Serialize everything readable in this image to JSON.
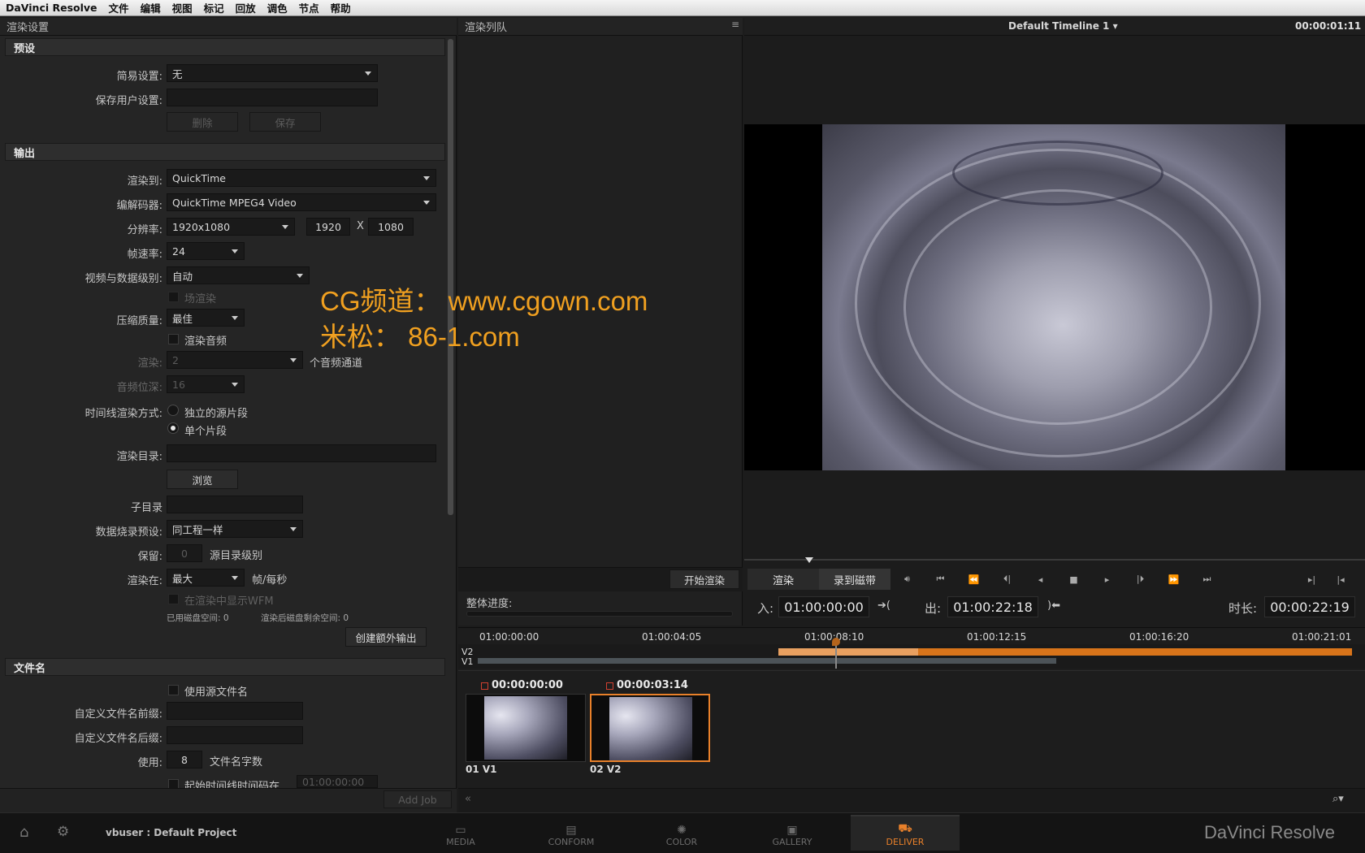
{
  "menu": [
    "DaVinci Resolve",
    "文件",
    "编辑",
    "视图",
    "标记",
    "回放",
    "调色",
    "节点",
    "帮助"
  ],
  "left_panel": {
    "title": "渲染设置",
    "preset_section": "预设",
    "easy_setup_label": "简易设置:",
    "easy_setup_value": "无",
    "save_user_label": "保存用户设置:",
    "delete_btn": "删除",
    "save_btn": "保存",
    "output_section": "输出",
    "render_to_label": "渲染到:",
    "render_to_value": "QuickTime",
    "codec_label": "编解码器:",
    "codec_value": "QuickTime MPEG4 Video",
    "resolution_label": "分辨率:",
    "resolution_value": "1920x1080",
    "width": "1920",
    "x_sep": "X",
    "height": "1080",
    "fps_label": "帧速率:",
    "fps_value": "24",
    "video_level_label": "视频与数据级别:",
    "video_level_value": "自动",
    "field_render": "场渲染",
    "quality_label": "压缩质量:",
    "quality_value": "最佳",
    "render_audio": "渲染音频",
    "render_label": "渲染:",
    "render_channels": "2",
    "channels_text": "个音频通道",
    "audio_bits_label": "音频位深:",
    "audio_bits_value": "16",
    "timeline_mode_label": "时间线渲染方式:",
    "mode_individual": "独立的源片段",
    "mode_single": "单个片段",
    "render_dir_label": "渲染目录:",
    "browse_btn": "浏览",
    "subdir_label": "子目录",
    "burn_label": "数据烧录预设:",
    "burn_value": "同工程一样",
    "keep_label": "保留:",
    "keep_value": "0",
    "keep_suffix": "源目录级别",
    "render_at_label": "渲染在:",
    "render_at_value": "最大",
    "render_at_suffix": "帧/每秒",
    "show_wfm": "在渲染中显示WFM",
    "disk_used": "已用磁盘空间: 0",
    "disk_left": "渲染后磁盘剩余空间: 0",
    "create_output_btn": "创建额外输出",
    "filename_section": "文件名",
    "use_source_name": "使用源文件名",
    "prefix_label": "自定义文件名前缀:",
    "suffix_label": "自定义文件名后缀:",
    "use_label": "使用:",
    "use_value": "8",
    "use_suffix": "文件名字数",
    "start_tc_label": "起始时间线时间码在",
    "start_tc_value": "01:00:00:00",
    "add_job_btn": "Add Job"
  },
  "queue": {
    "title": "渲染列队",
    "start_render_btn": "开始渲染",
    "progress_label": "整体进度:"
  },
  "viewer": {
    "timeline_name": "Default Timeline 1",
    "timecode": "00:00:01:11",
    "tab_render": "渲染",
    "tab_tape": "录到磁带",
    "in_label": "入:",
    "in_value": "01:00:00:00",
    "out_label": "出:",
    "out_value": "01:00:22:18",
    "dur_label": "时长:",
    "dur_value": "00:00:22:19"
  },
  "timeline": {
    "ticks": [
      "01:00:00:00",
      "01:00:04:05",
      "01:00:08:10",
      "01:00:12:15",
      "01:00:16:20",
      "01:00:21:01"
    ],
    "track_v2": "V2",
    "track_v1": "V1",
    "clips": [
      {
        "tc": "00:00:00:00",
        "label": "01 V1"
      },
      {
        "tc": "00:00:03:14",
        "label": "02 V2"
      }
    ]
  },
  "bottom": {
    "user": "vbuser : Default Project",
    "nav": [
      "MEDIA",
      "CONFORM",
      "COLOR",
      "GALLERY",
      "DELIVER"
    ],
    "brand": "DaVinci Resolve"
  },
  "watermark": {
    "line1": "CG频道：  www.cgown.com",
    "line2": "米松：  86-1.com"
  },
  "colors": {
    "accent": "#e8802a",
    "watermark": "#f0a020"
  }
}
